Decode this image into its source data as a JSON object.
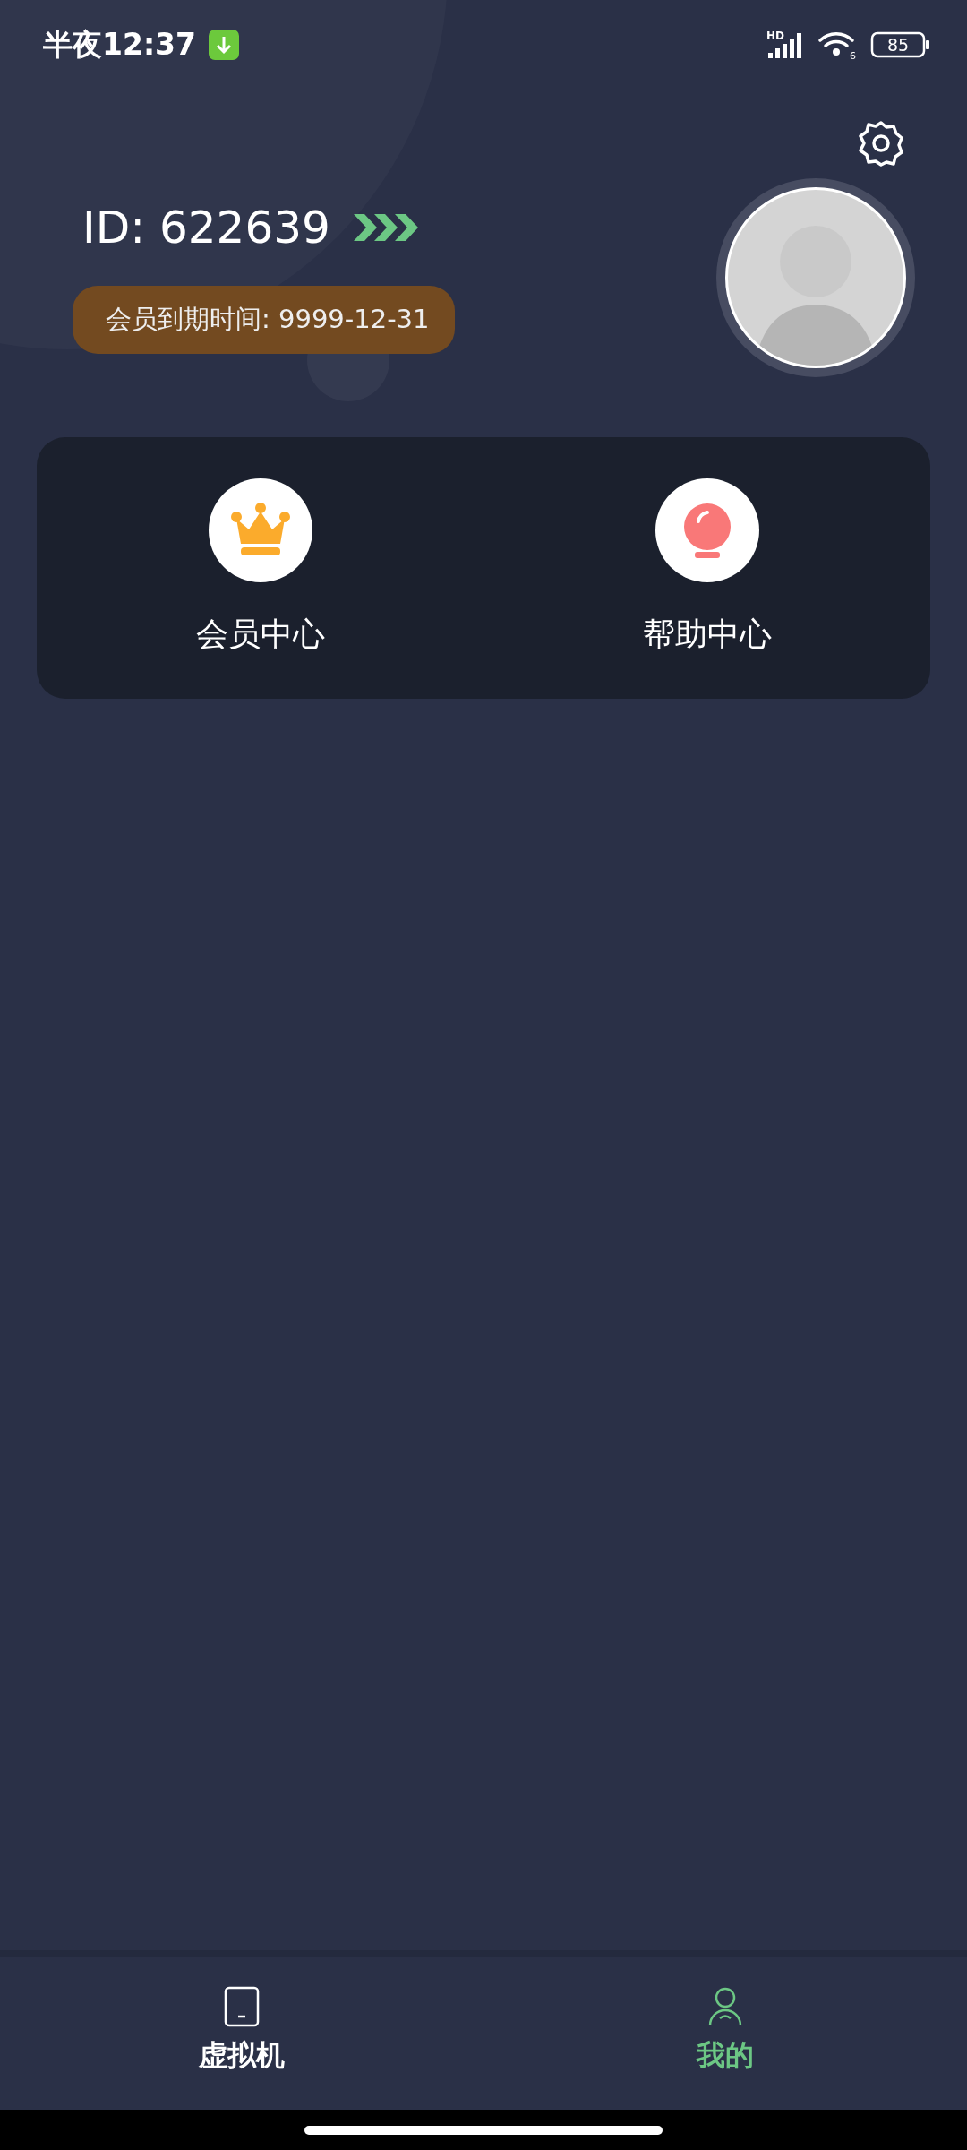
{
  "status_bar": {
    "time": "半夜12:37",
    "network_label": "HD",
    "wifi_label": "6",
    "battery": "85"
  },
  "profile": {
    "id": "ID: 622639",
    "membership_expiry": "会员到期时间: 9999-12-31"
  },
  "shortcuts": [
    {
      "kind": "crown",
      "label": "会员中心"
    },
    {
      "kind": "bulb",
      "label": "帮助中心"
    }
  ],
  "bottom_nav": [
    {
      "kind": "device",
      "label": "虚拟机",
      "selected": false
    },
    {
      "kind": "person",
      "label": "我的",
      "selected": true
    }
  ]
}
